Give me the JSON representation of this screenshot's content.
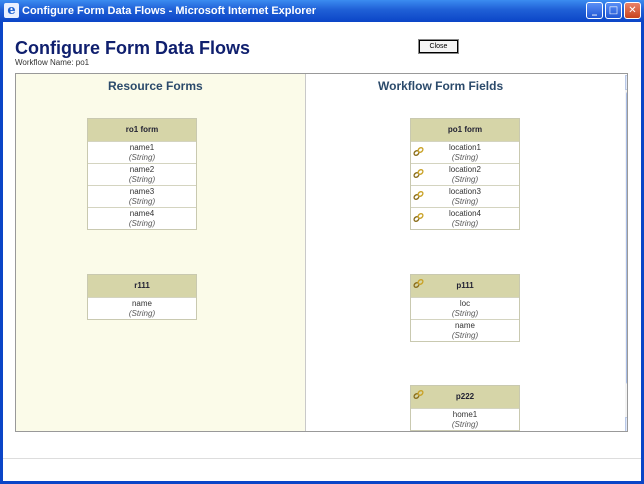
{
  "window": {
    "title": "Configure Form Data Flows - Microsoft Internet Explorer",
    "app_icon": "ie-icon",
    "controls": [
      "minimize",
      "maximize",
      "close"
    ]
  },
  "page": {
    "title": "Configure Form Data Flows",
    "workflow_label": "Workflow Name: po1",
    "close_button": "Close"
  },
  "resource_pane": {
    "heading": "Resource Forms",
    "forms": [
      {
        "title": "ro1 form",
        "fields": [
          {
            "name": "name1",
            "type": "(String)"
          },
          {
            "name": "name2",
            "type": "(String)"
          },
          {
            "name": "name3",
            "type": "(String)"
          },
          {
            "name": "name4",
            "type": "(String)"
          }
        ]
      },
      {
        "title": "r111",
        "fields": [
          {
            "name": "name",
            "type": "(String)"
          }
        ]
      }
    ]
  },
  "workflow_pane": {
    "heading": "Workflow Form Fields",
    "forms": [
      {
        "title": "po1 form",
        "fields": [
          {
            "name": "location1",
            "type": "(String)",
            "icon": "link-icon"
          },
          {
            "name": "location2",
            "type": "(String)",
            "icon": "link-icon"
          },
          {
            "name": "location3",
            "type": "(String)",
            "icon": "link-icon"
          },
          {
            "name": "location4",
            "type": "(String)",
            "icon": "link-icon"
          }
        ]
      },
      {
        "title": "p111",
        "header_icon": "link-icon",
        "fields": [
          {
            "name": "loc",
            "type": "(String)"
          },
          {
            "name": "name",
            "type": "(String)"
          }
        ]
      },
      {
        "title": "p222",
        "header_icon": "link-icon",
        "fields": [
          {
            "name": "home1",
            "type": "(String)"
          }
        ]
      }
    ]
  }
}
